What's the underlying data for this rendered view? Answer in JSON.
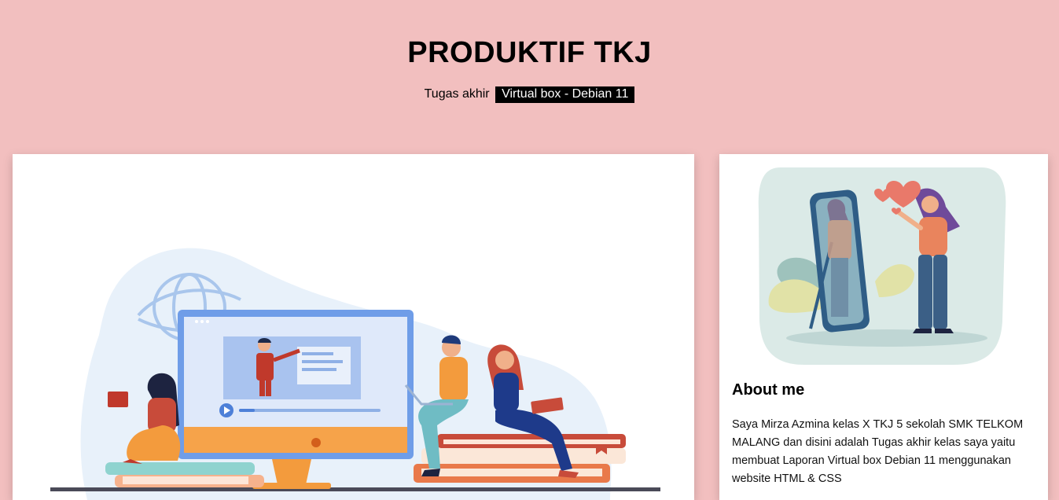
{
  "header": {
    "title": "PRODUKTIF TKJ",
    "subtitle_text": "Tugas akhir",
    "subtitle_badge": "Virtual box - Debian 11"
  },
  "sidebar": {
    "about_title": "About me",
    "about_text": "Saya Mirza Azmina kelas X TKJ 5 sekolah SMK TELKOM MALANG dan disini adalah Tugas akhir kelas saya yaitu membuat Laporan Virtual box Debian 11 menggunakan website HTML & CSS"
  },
  "colors": {
    "page_background": "#f2bfbf",
    "card_background": "#ffffff",
    "badge_background": "#000000",
    "badge_text": "#ffffff"
  }
}
